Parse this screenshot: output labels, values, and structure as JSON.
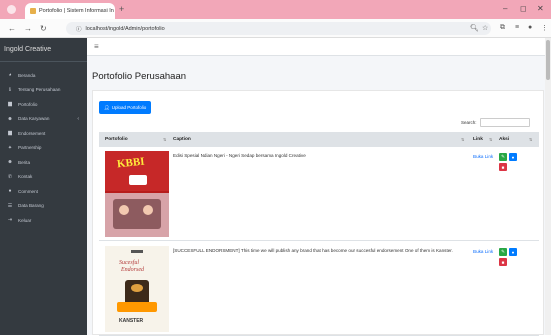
{
  "browser": {
    "tab_title": "Portofolio | Sistem Informasi In",
    "url": "localhost/ingold/Admin/portofolio",
    "new_tab": "+",
    "minimize": "–",
    "maximize": "◻",
    "close": "✕"
  },
  "sidebar": {
    "brand": "Ingold Creative",
    "items": [
      {
        "label": "Beranda",
        "icon": "dashboard-icon"
      },
      {
        "label": "Tentang Perusahaan",
        "icon": "info-icon"
      },
      {
        "label": "Portofolio",
        "icon": "file-icon"
      },
      {
        "label": "Data Karyawan",
        "icon": "users-icon"
      },
      {
        "label": "Endorsement",
        "icon": "file-icon"
      },
      {
        "label": "Partnership",
        "icon": "handshake-icon"
      },
      {
        "label": "Berita",
        "icon": "users-icon"
      },
      {
        "label": "Kontak",
        "icon": "phone-icon"
      },
      {
        "label": "Comment",
        "icon": "comment-icon"
      },
      {
        "label": "Data Barang",
        "icon": "list-icon"
      },
      {
        "label": "Keluar",
        "icon": "logout-icon"
      }
    ]
  },
  "main": {
    "menu_icon": "≡",
    "page_title": "Portofolio Perusahaan",
    "upload_button": "Upload Portofolio",
    "search_label": "Search:",
    "table": {
      "headers": [
        "Portofolio",
        "Caption",
        "Link",
        "Aksi"
      ],
      "rows": [
        {
          "caption": "Edisi Spesial Ndian Ngeri - Ngeri Sedap bersama Ingold Creative",
          "link": "Buka Link",
          "thumb_text": "KBBI"
        },
        {
          "caption": "[SUCCESFULL ENDORSMENT] This time we will publish any brand that has become our succesful endorsement One of them is Kanster.",
          "link": "Buka Link",
          "thumb_text": "KANSTER"
        }
      ]
    }
  },
  "colors": {
    "chrome": "#f2a7b8",
    "sidebar": "#343a40",
    "primary": "#007bff",
    "edit": "#28a745",
    "delete": "#dc3545"
  }
}
